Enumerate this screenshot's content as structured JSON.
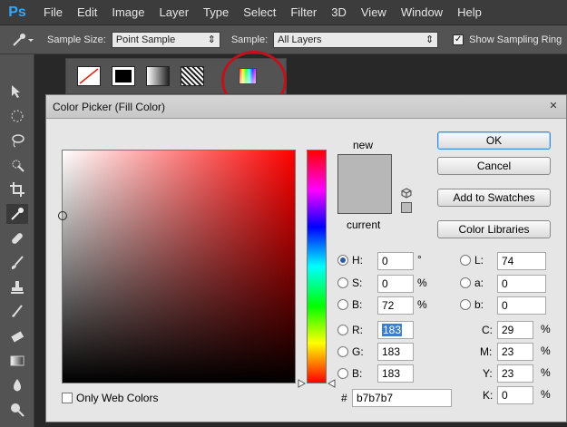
{
  "menubar": {
    "logo": "Ps",
    "items": [
      "File",
      "Edit",
      "Image",
      "Layer",
      "Type",
      "Select",
      "Filter",
      "3D",
      "View",
      "Window",
      "Help"
    ]
  },
  "options": {
    "sample_size_label": "Sample Size:",
    "sample_size_value": "Point Sample",
    "sample_label": "Sample:",
    "sample_value": "All Layers",
    "show_ring_label": "Show Sampling Ring"
  },
  "dialog": {
    "title": "Color Picker (Fill Color)",
    "new_label": "new",
    "current_label": "current",
    "only_web_colors": "Only Web Colors",
    "buttons": {
      "ok": "OK",
      "cancel": "Cancel",
      "add": "Add to Swatches",
      "libraries": "Color Libraries"
    },
    "hsb": [
      {
        "label": "H:",
        "value": "0",
        "unit": "°"
      },
      {
        "label": "S:",
        "value": "0",
        "unit": "%"
      },
      {
        "label": "B:",
        "value": "72",
        "unit": "%"
      }
    ],
    "rgb": [
      {
        "label": "R:",
        "value": "183"
      },
      {
        "label": "G:",
        "value": "183"
      },
      {
        "label": "B:",
        "value": "183"
      }
    ],
    "lab": [
      {
        "label": "L:",
        "value": "74"
      },
      {
        "label": "a:",
        "value": "0"
      },
      {
        "label": "b:",
        "value": "0"
      }
    ],
    "cmyk": [
      {
        "label": "C:",
        "value": "29",
        "unit": "%"
      },
      {
        "label": "M:",
        "value": "23",
        "unit": "%"
      },
      {
        "label": "Y:",
        "value": "23",
        "unit": "%"
      },
      {
        "label": "K:",
        "value": "0",
        "unit": "%"
      }
    ],
    "hex_label": "#",
    "hex_value": "b7b7b7",
    "new_color": "#b7b7b7",
    "current_color": "#b7b7b7"
  }
}
